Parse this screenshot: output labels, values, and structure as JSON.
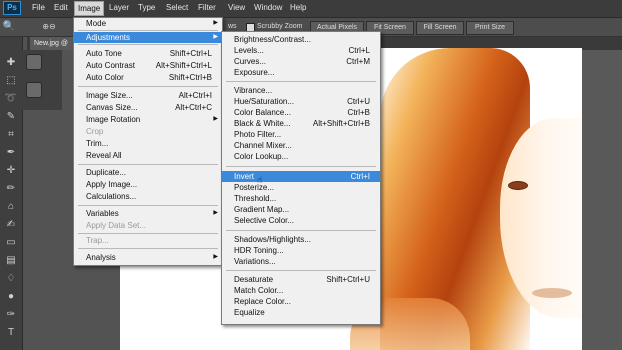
{
  "app": {
    "logo": "Ps"
  },
  "menubar": [
    "File",
    "Edit",
    "Image",
    "Layer",
    "Type",
    "Select",
    "Filter",
    "View",
    "Window",
    "Help"
  ],
  "options_bar": {
    "zoom_tail": "ws",
    "scrubby_zoom": "Scrubby Zoom",
    "buttons": [
      "Actual Pixels",
      "Fit Screen",
      "Fill Screen",
      "Print Size"
    ]
  },
  "document_tab": "New.jpg @",
  "image_menu": [
    {
      "label": "Mode",
      "submenu": true
    },
    {
      "label": "Adjustments",
      "submenu": true,
      "highlighted": true
    },
    {
      "label": "Auto Tone",
      "shortcut": "Shift+Ctrl+L"
    },
    {
      "label": "Auto Contrast",
      "shortcut": "Alt+Shift+Ctrl+L"
    },
    {
      "label": "Auto Color",
      "shortcut": "Shift+Ctrl+B"
    },
    {
      "label": "Image Size...",
      "shortcut": "Alt+Ctrl+I"
    },
    {
      "label": "Canvas Size...",
      "shortcut": "Alt+Ctrl+C"
    },
    {
      "label": "Image Rotation",
      "submenu": true
    },
    {
      "label": "Crop",
      "disabled": true
    },
    {
      "label": "Trim..."
    },
    {
      "label": "Reveal All"
    },
    {
      "label": "Duplicate..."
    },
    {
      "label": "Apply Image..."
    },
    {
      "label": "Calculations..."
    },
    {
      "label": "Variables",
      "submenu": true
    },
    {
      "label": "Apply Data Set...",
      "disabled": true
    },
    {
      "label": "Trap...",
      "disabled": true
    },
    {
      "label": "Analysis",
      "submenu": true
    }
  ],
  "adjustments_menu": [
    {
      "label": "Brightness/Contrast..."
    },
    {
      "label": "Levels...",
      "shortcut": "Ctrl+L"
    },
    {
      "label": "Curves...",
      "shortcut": "Ctrl+M"
    },
    {
      "label": "Exposure..."
    },
    {
      "label": "Vibrance..."
    },
    {
      "label": "Hue/Saturation...",
      "shortcut": "Ctrl+U"
    },
    {
      "label": "Color Balance...",
      "shortcut": "Ctrl+B"
    },
    {
      "label": "Black & White...",
      "shortcut": "Alt+Shift+Ctrl+B"
    },
    {
      "label": "Photo Filter..."
    },
    {
      "label": "Channel Mixer..."
    },
    {
      "label": "Color Lookup..."
    },
    {
      "label": "Invert",
      "shortcut": "Ctrl+I",
      "highlighted": true
    },
    {
      "label": "Posterize..."
    },
    {
      "label": "Threshold..."
    },
    {
      "label": "Gradient Map..."
    },
    {
      "label": "Selective Color..."
    },
    {
      "label": "Shadows/Highlights..."
    },
    {
      "label": "HDR Toning..."
    },
    {
      "label": "Variations..."
    },
    {
      "label": "Desaturate",
      "shortcut": "Shift+Ctrl+U"
    },
    {
      "label": "Match Color..."
    },
    {
      "label": "Replace Color..."
    },
    {
      "label": "Equalize"
    }
  ],
  "colors": {
    "highlight": "#3a89db",
    "menubar": "#3c3c3c",
    "workspace": "#535353"
  }
}
